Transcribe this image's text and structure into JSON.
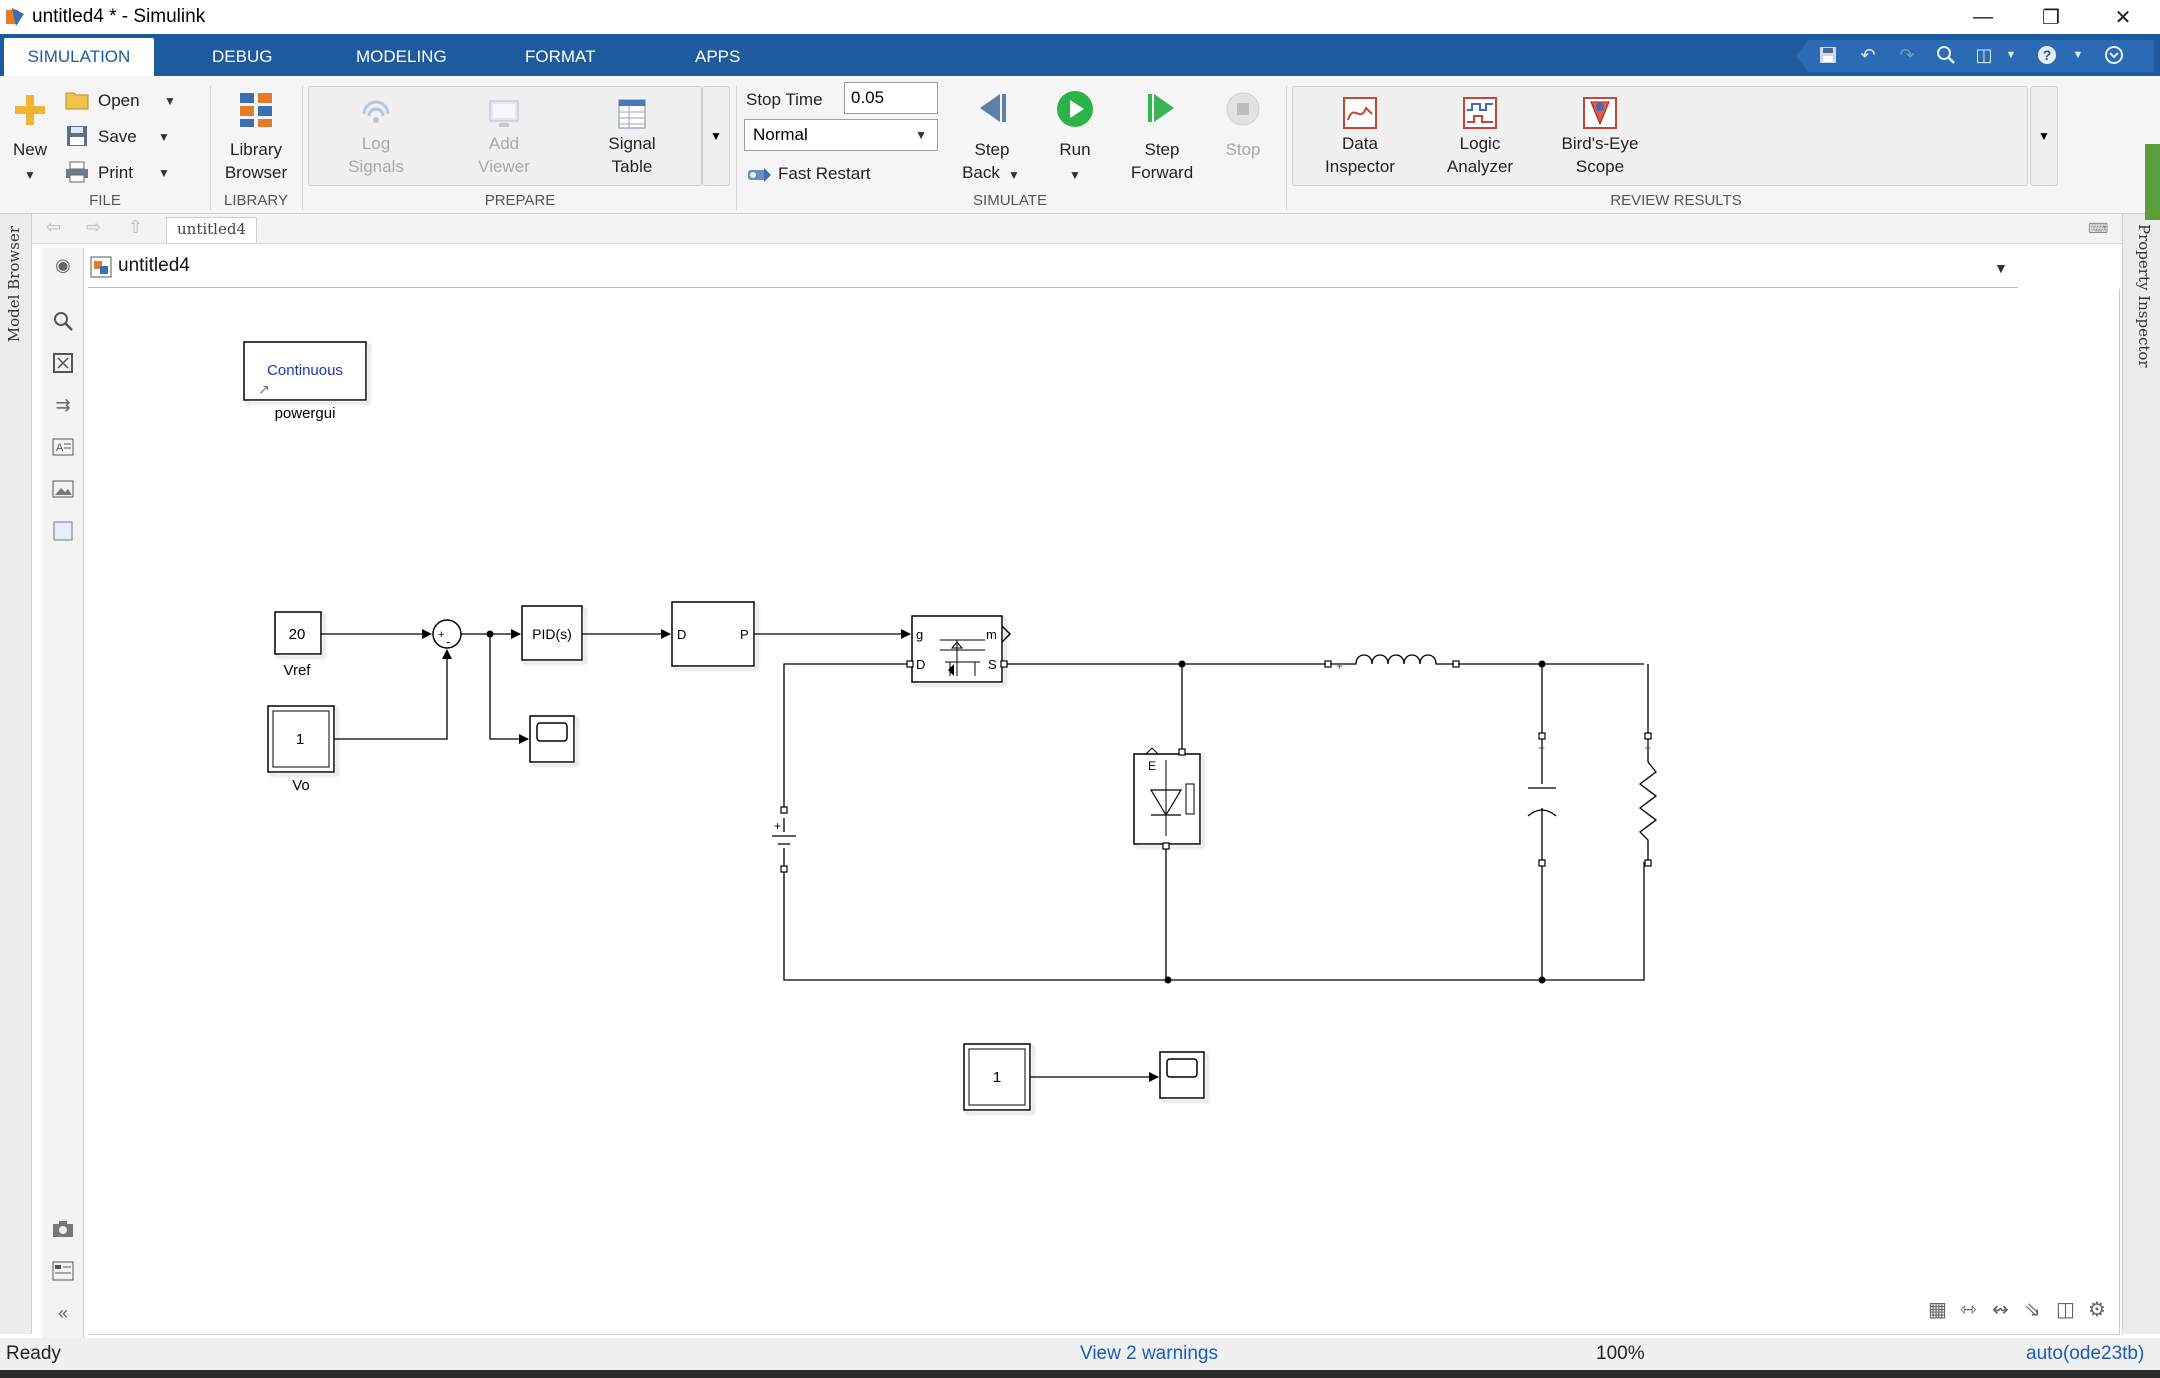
{
  "window": {
    "title": "untitled4 * - Simulink"
  },
  "tabs": [
    {
      "label": "SIMULATION",
      "active": true
    },
    {
      "label": "DEBUG"
    },
    {
      "label": "MODELING"
    },
    {
      "label": "FORMAT"
    },
    {
      "label": "APPS"
    }
  ],
  "ribbon": {
    "file": {
      "title": "FILE",
      "new_label": "New",
      "open_label": "Open",
      "save_label": "Save",
      "print_label": "Print"
    },
    "library": {
      "title": "LIBRARY",
      "browser_label_1": "Library",
      "browser_label_2": "Browser"
    },
    "prepare": {
      "title": "PREPARE",
      "log_signals_1": "Log",
      "log_signals_2": "Signals",
      "add_viewer_1": "Add",
      "add_viewer_2": "Viewer",
      "signal_table_1": "Signal",
      "signal_table_2": "Table"
    },
    "simulate": {
      "title": "SIMULATE",
      "stop_time_label": "Stop Time",
      "stop_time_value": "0.05",
      "mode_value": "Normal",
      "fast_restart_label": "Fast Restart",
      "step_back_1": "Step",
      "step_back_2": "Back",
      "run_label": "Run",
      "step_forward_1": "Step",
      "step_forward_2": "Forward",
      "stop_label": "Stop"
    },
    "review": {
      "title": "REVIEW RESULTS",
      "data_inspector_1": "Data",
      "data_inspector_2": "Inspector",
      "logic_analyzer_1": "Logic",
      "logic_analyzer_2": "Analyzer",
      "birds_eye_1": "Bird's-Eye",
      "birds_eye_2": "Scope"
    }
  },
  "breadcrumb": {
    "tab": "untitled4",
    "path": "untitled4"
  },
  "side_panels": {
    "left": "Model Browser",
    "right": "Property Inspector"
  },
  "model": {
    "powergui_text": "Continuous",
    "powergui_label": "powergui",
    "vref_value": "20",
    "vref_label": "Vref",
    "vo_value": "1",
    "vo_label": "Vo",
    "sum_plus": "+",
    "sum_minus": "-",
    "pid_text": "PID(s)",
    "pwm_in": "D",
    "pwm_out": "P",
    "mosfet_g": "g",
    "mosfet_m": "m",
    "mosfet_d": "D",
    "mosfet_s": "S",
    "const2_value": "1",
    "diode_e": "E"
  },
  "status": {
    "left": "Ready",
    "warnings": "View 2 warnings",
    "zoom": "100%",
    "solver": "auto(ode23tb)"
  },
  "colors": {
    "ribbon_blue": "#1e5a9e",
    "run_green": "#2bb34a",
    "link_blue": "#1c5db4"
  }
}
